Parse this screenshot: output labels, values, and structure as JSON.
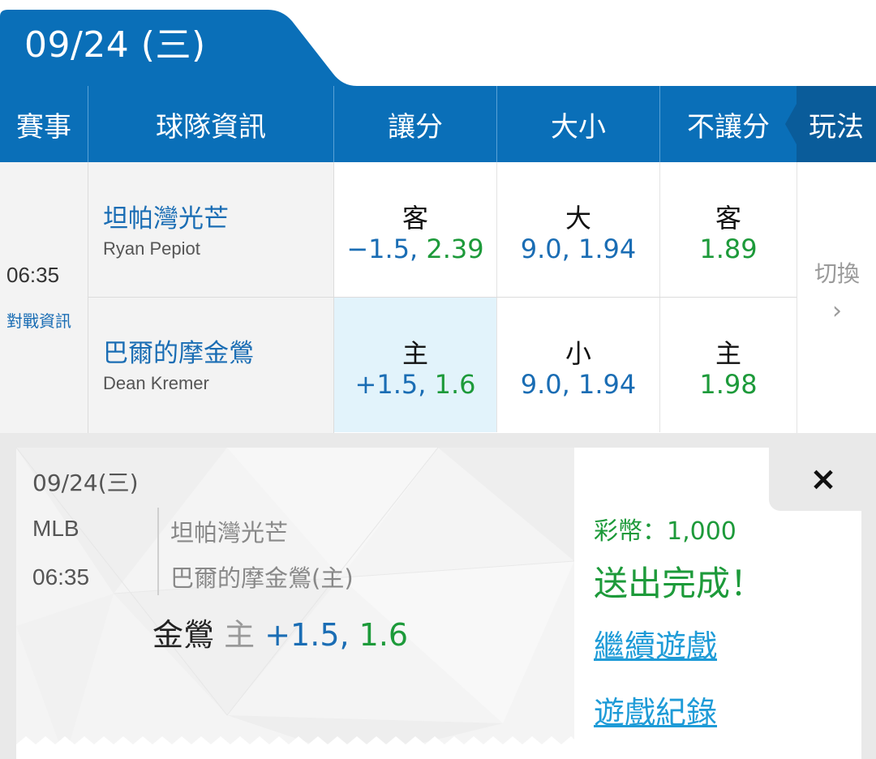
{
  "date_tab": {
    "label": "09/24 (三)"
  },
  "header": {
    "event": "賽事",
    "team_info": "球隊資訊",
    "handicap": "讓分",
    "over_under": "大小",
    "moneyline": "不讓分",
    "play_type": "玩法"
  },
  "match": {
    "time": "06:35",
    "info_link": "對戰資訊",
    "away": {
      "team": "坦帕灣光芒",
      "pitcher": "Ryan Pepiot",
      "handicap_label": "客",
      "handicap_line": "−1.5,",
      "handicap_odds": "2.39",
      "ou_label": "大",
      "ou_value": "9.0, 1.94",
      "ml_label": "客",
      "ml_odds": "1.89"
    },
    "home": {
      "team": "巴爾的摩金鶯",
      "pitcher": "Dean Kremer",
      "handicap_label": "主",
      "handicap_line": "+1.5,",
      "handicap_odds": "1.6",
      "ou_label": "小",
      "ou_value": "9.0, 1.94",
      "ml_label": "主",
      "ml_odds": "1.98"
    },
    "switch_label": "切換",
    "switch_chevron": "›"
  },
  "ticket": {
    "date": "09/24(三)",
    "league": "MLB",
    "time": "06:35",
    "away_team": "坦帕灣光芒",
    "home_team": "巴爾的摩金鶯(主)",
    "pick_name": "金鶯",
    "pick_side": "主",
    "pick_line": "+1.5,",
    "pick_odds": "1.6"
  },
  "result": {
    "coins": "彩幣：1,000",
    "status": "送出完成！",
    "continue_link": "繼續遊戲",
    "history_link": "遊戲紀錄",
    "close_icon": "×"
  },
  "colors": {
    "header_blue": "#0a6fb8",
    "dark_blue": "#0a5c9a",
    "odds_blue": "#1a6db4",
    "odds_green": "#1d9a3a",
    "link_blue": "#1e9bd7",
    "selected_bg": "#e2f3fb"
  }
}
